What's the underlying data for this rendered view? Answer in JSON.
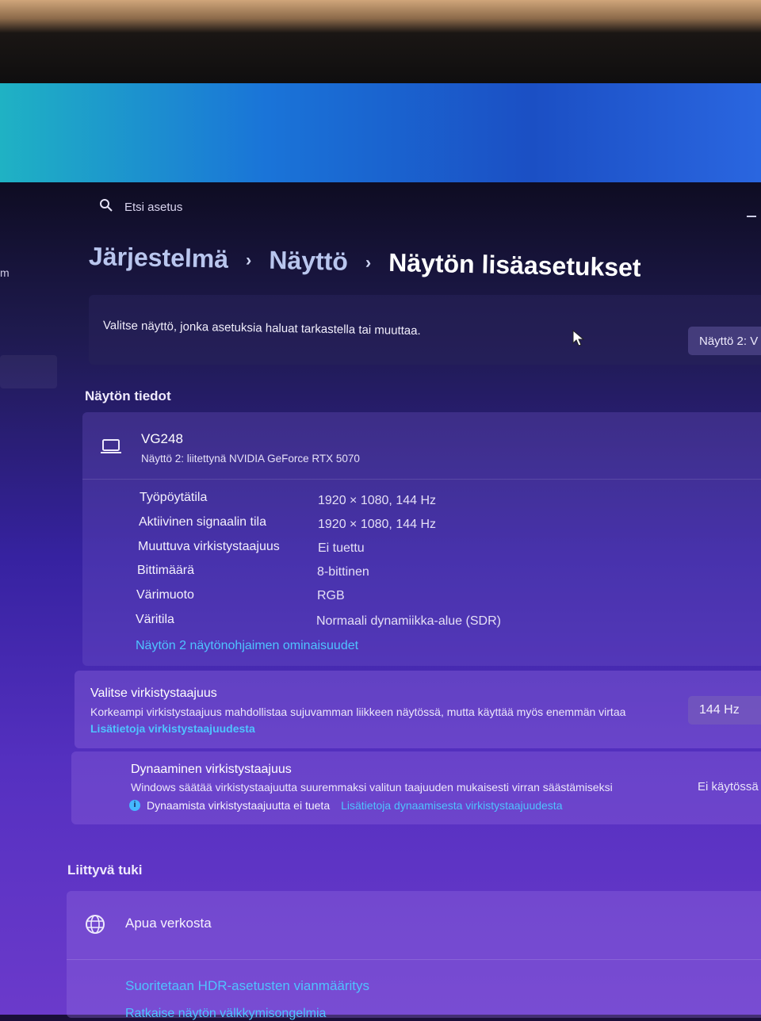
{
  "search": {
    "placeholder": "Etsi asetus"
  },
  "sidebar": {
    "fragment": "m"
  },
  "breadcrumb": {
    "items": [
      "Järjestelmä",
      "Näyttö",
      "Näytön lisäasetukset"
    ],
    "separator": "›"
  },
  "display_select": {
    "description": "Valitse näyttö, jonka asetuksia haluat tarkastella tai muuttaa.",
    "selected": "Näyttö 2: V"
  },
  "display_info": {
    "section_title": "Näytön tiedot",
    "monitor_name": "VG248",
    "monitor_sub": "Näyttö 2: liitettynä NVIDIA GeForce RTX 5070",
    "rows": [
      {
        "label": "Työpöytätila",
        "value": "1920 × 1080, 144 Hz"
      },
      {
        "label": "Aktiivinen signaalin tila",
        "value": "1920 × 1080, 144 Hz"
      },
      {
        "label": "Muuttuva virkistystaajuus",
        "value": "Ei tuettu"
      },
      {
        "label": "Bittimäärä",
        "value": "8-bittinen"
      },
      {
        "label": "Värimuoto",
        "value": "RGB"
      },
      {
        "label": "Väritila",
        "value": "Normaali dynamiikka-alue (SDR)"
      }
    ],
    "gpu_link": "Näytön 2 näytönohjaimen ominaisuudet"
  },
  "refresh_rate": {
    "title": "Valitse virkistystaajuus",
    "description": "Korkeampi virkistystaajuus mahdollistaa sujuvamman liikkeen näytössä, mutta käyttää myös enemmän virtaa",
    "link": "Lisätietoja virkistystaajuudesta",
    "selected": "144 Hz"
  },
  "dynamic_refresh": {
    "title": "Dynaaminen virkistystaajuus",
    "description": "Windows säätää virkistystaajuutta suuremmaksi valitun taajuuden mukaisesti virran säästämiseksi",
    "note": "Dynaamista virkistystaajuutta ei tueta",
    "link": "Lisätietoja dynaamisesta virkistystaajuudesta",
    "state": "Ei käytössä"
  },
  "related_support": {
    "section_title": "Liittyvä tuki",
    "help_label": "Apua verkosta",
    "hdr_link": "Suoritetaan HDR-asetusten vianmääritys",
    "partial_link": "Ratkaise näytön välkkymisongelmia"
  },
  "colors": {
    "accent": "#4fc3ff",
    "info": "#45b8ff"
  }
}
